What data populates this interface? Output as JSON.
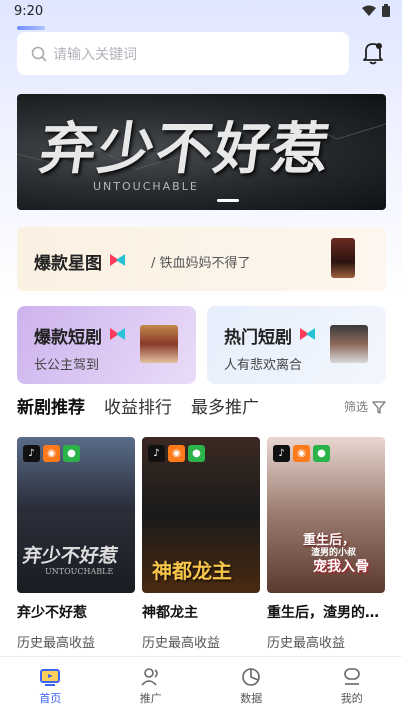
{
  "status": {
    "time": "9:20"
  },
  "search": {
    "placeholder": "请输入关键词"
  },
  "banner": {
    "title": "弃少不好惹",
    "subtitle": "UNTOUCHABLE"
  },
  "star_card": {
    "title": "爆款星图",
    "subtitle": "/ 铁血妈妈不得了"
  },
  "hot_short_left": {
    "title": "爆款短剧",
    "subtitle": "长公主驾到"
  },
  "hot_short_right": {
    "title": "热门短剧",
    "subtitle": "人有悲欢离合"
  },
  "tabs": [
    {
      "label": "新剧推荐",
      "active": true
    },
    {
      "label": "收益排行",
      "active": false
    },
    {
      "label": "最多推广",
      "active": false
    }
  ],
  "filter_label": "筛选",
  "dramas": [
    {
      "name": "弃少不好惹",
      "label": "历史最高收益",
      "poster_text": "弃少不好惹",
      "poster_sub": "UNTOUCHABLE"
    },
    {
      "name": "神都龙主",
      "label": "历史最高收益",
      "poster_text": "神都龙主"
    },
    {
      "name": "重生后，渣男的…",
      "label": "历史最高收益",
      "poster_text_1": "重生后，",
      "poster_text_2": "渣男的小叔",
      "poster_text_3": "宠我入骨"
    }
  ],
  "nav": [
    {
      "label": "首页",
      "icon": "home-tv-icon",
      "active": true
    },
    {
      "label": "推广",
      "icon": "users-icon",
      "active": false
    },
    {
      "label": "数据",
      "icon": "pie-chart-icon",
      "active": false
    },
    {
      "label": "我的",
      "icon": "profile-icon",
      "active": false
    }
  ],
  "colors": {
    "accent": "#3d63f2",
    "douyin": "#111111",
    "kuaishou": "#ff7a1a",
    "wechat": "#2bb34a"
  }
}
